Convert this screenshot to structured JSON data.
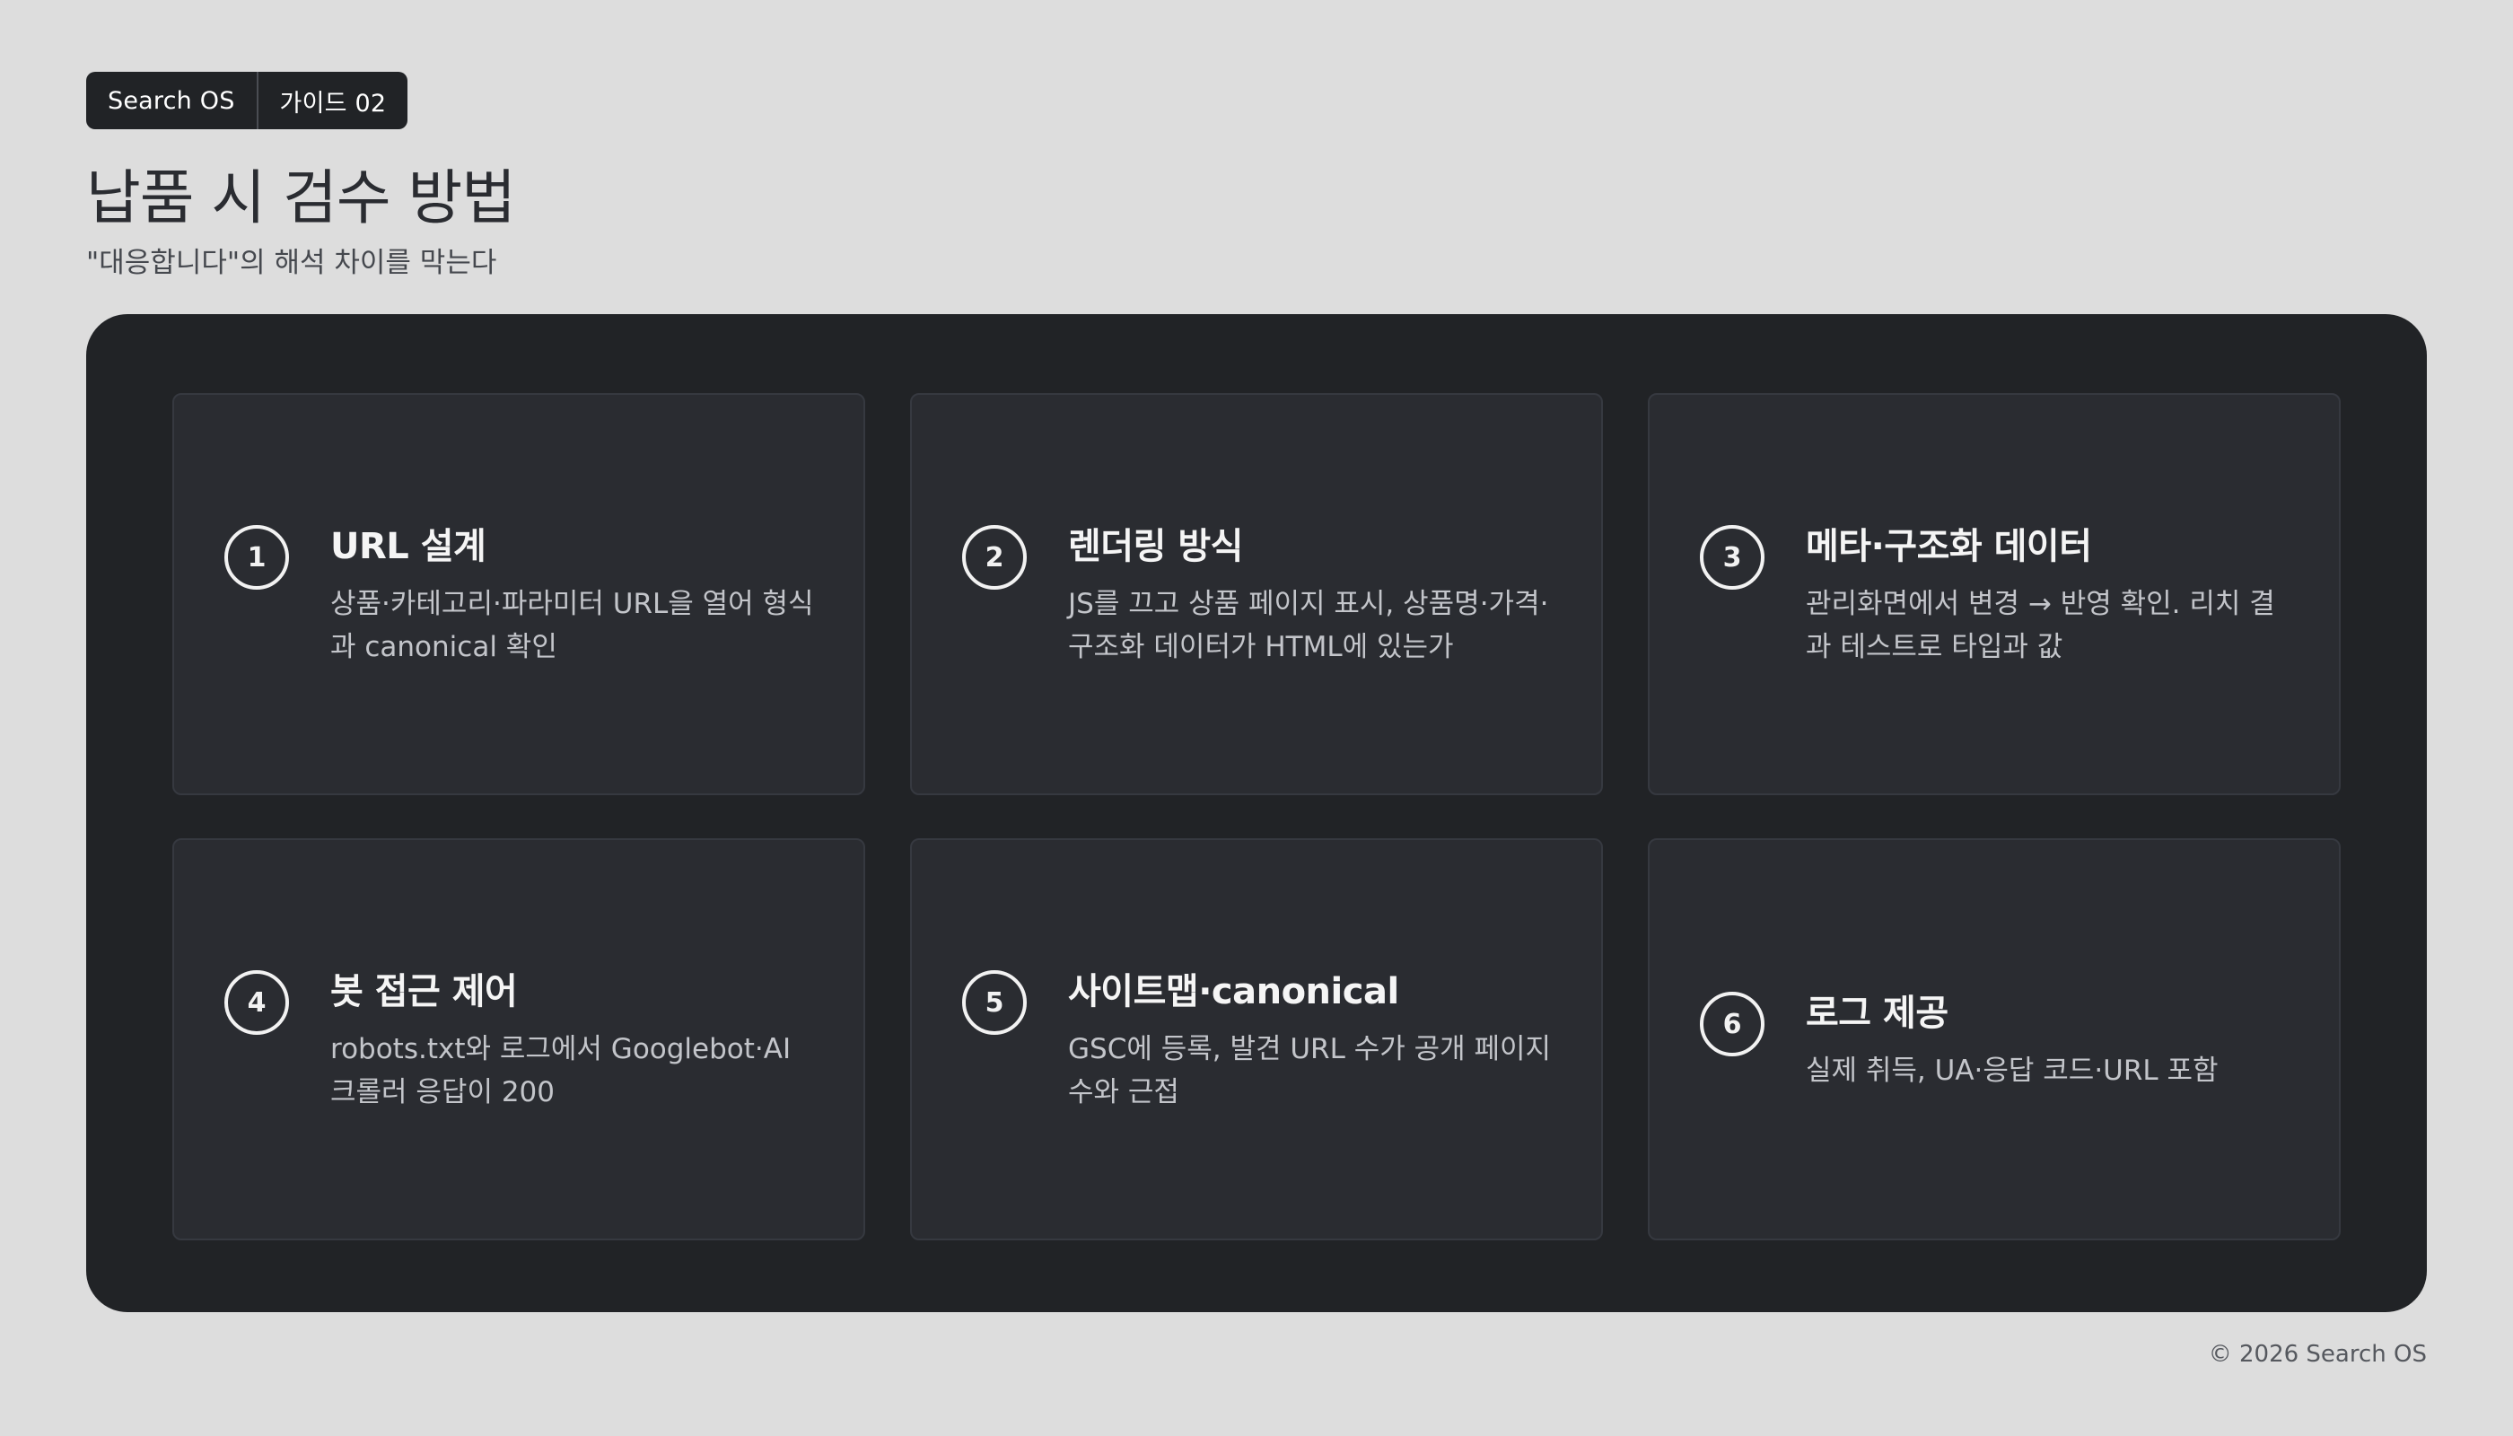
{
  "badge": {
    "brand": "Search OS",
    "guide": "가이드 02"
  },
  "title": "납품 시 검수 방법",
  "subtitle": "\"대응합니다\"의 해석 차이를 막는다",
  "cards": [
    {
      "num": "1",
      "title": "URL 설계",
      "desc": "상품·카테고리·파라미터 URL을 열어 형식과 canonical 확인"
    },
    {
      "num": "2",
      "title": "렌더링 방식",
      "desc": "JS를 끄고 상품 페이지 표시, 상품명·가격·구조화 데이터가 HTML에 있는가"
    },
    {
      "num": "3",
      "title": "메타·구조화 데이터",
      "desc": "관리화면에서 변경 → 반영 확인. 리치 결과 테스트로 타입과 값"
    },
    {
      "num": "4",
      "title": "봇 접근 제어",
      "desc": "robots.txt와 로그에서 Googlebot·AI 크롤러 응답이 200"
    },
    {
      "num": "5",
      "title": "사이트맵·canonical",
      "desc": "GSC에 등록, 발견 URL 수가 공개 페이지 수와 근접"
    },
    {
      "num": "6",
      "title": "로그 제공",
      "desc": "실제 취득, UA·응답 코드·URL 포함"
    }
  ],
  "footer": "© 2026 Search OS"
}
